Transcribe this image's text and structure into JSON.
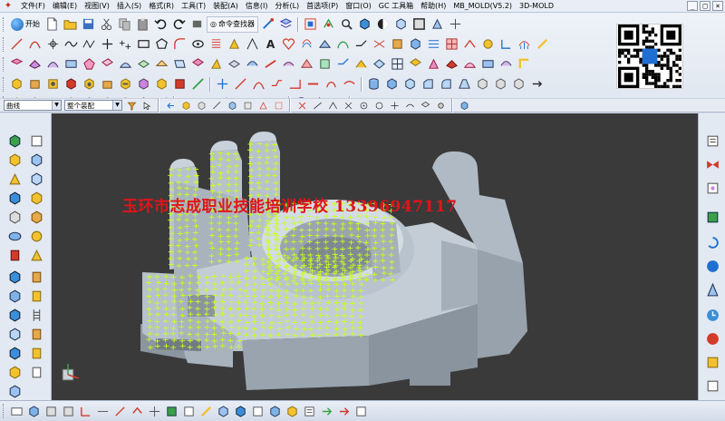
{
  "menubar": {
    "items": [
      "文件(F)",
      "编辑(E)",
      "视图(V)",
      "插入(S)",
      "格式(R)",
      "工具(T)",
      "装配(A)",
      "信息(I)",
      "分析(L)",
      "首选项(P)",
      "窗口(O)",
      "GC 工具箱",
      "帮助(H)",
      "MB_MOLD(V5.2)",
      "3D-MOLD"
    ],
    "window_controls": [
      "_",
      "□",
      "×"
    ]
  },
  "toolbar": {
    "start_label": "开始",
    "command_finder_label": "命令查找器"
  },
  "selection_bar": {
    "filter_value": "曲线",
    "scope_value": "整个装配"
  },
  "viewport": {
    "watermark": "玉环市志成职业技能培训学校 13396947117",
    "background": "#3a3a3a",
    "part_color": "#aeb8c2",
    "mesh_color": "#c8ff1e"
  },
  "icons": {
    "accent": "#1f6fd1",
    "yellow": "#f2c12e",
    "red": "#d23a2a",
    "green": "#3aa04a"
  }
}
